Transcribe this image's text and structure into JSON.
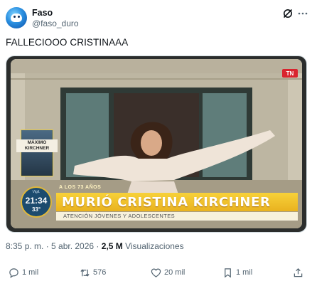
{
  "author": {
    "name": "Faso",
    "handle": "@faso_duro"
  },
  "post": {
    "text": "FALLECIOOO CRISTINAAA"
  },
  "media": {
    "sidebar_label": "MÁXIMO KIRCHNER",
    "clock_label": "Vigil.",
    "clock_time": "21:34",
    "clock_temp": "33°",
    "banner_kicker": "A LOS 73 AÑOS",
    "banner_title": "MURIÓ CRISTINA KIRCHNER",
    "banner_sub": "ATENCIÓN JÓVENES Y ADOLESCENTES",
    "channel_logo": "TN"
  },
  "meta": {
    "timestamp": "8:35 p. m. · 5 abr. 2026 · ",
    "views_count": "2,5 M",
    "views_label": " Visualizaciones"
  },
  "actions": {
    "replies": "1 mil",
    "reposts": "576",
    "likes": "20 mil",
    "bookmarks": "1 mil"
  },
  "colors": {
    "text_primary": "#0f1419",
    "text_secondary": "#536471",
    "border": "#cfd9de",
    "banner_yellow": "#f7d13a"
  }
}
